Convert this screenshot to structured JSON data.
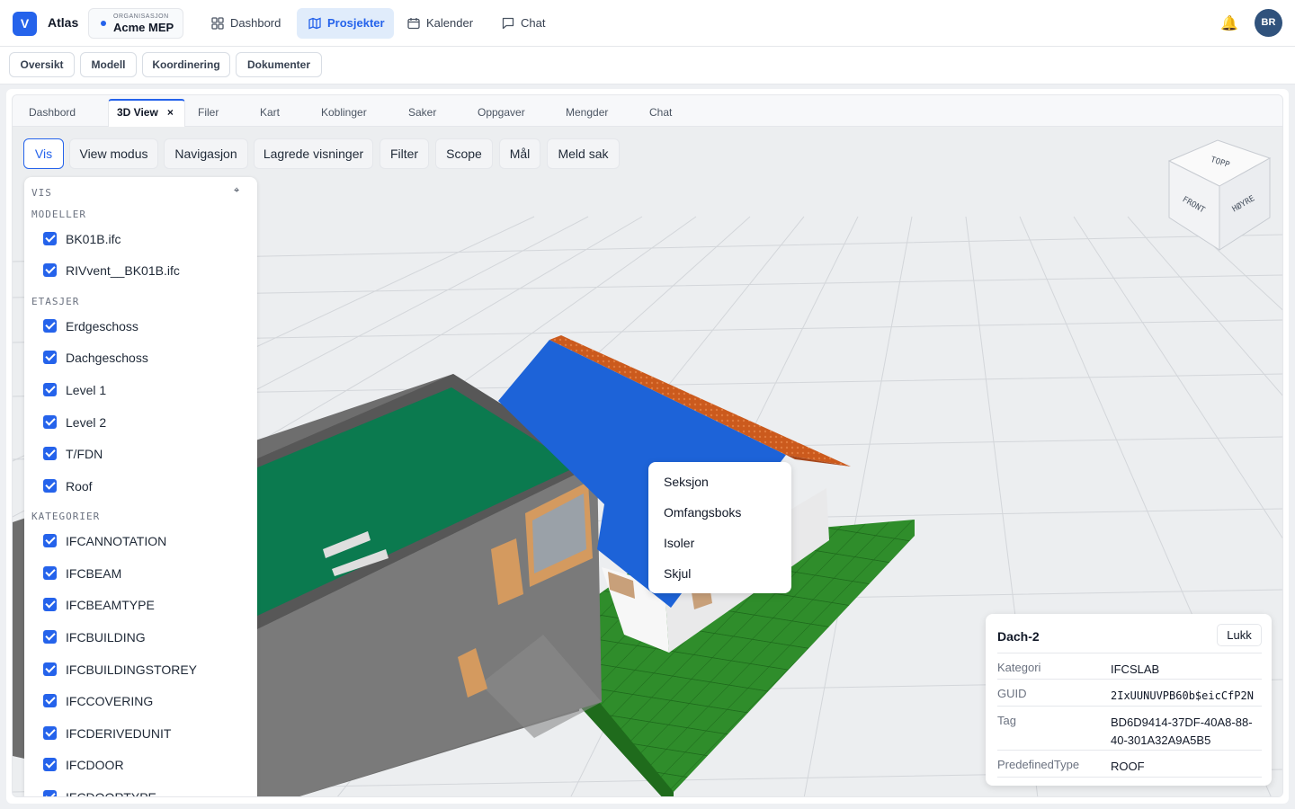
{
  "app": {
    "logo_letter": "V",
    "name": "Atlas"
  },
  "org": {
    "label": "ORGANISASJON",
    "name": "Acme MEP"
  },
  "nav": [
    {
      "label": "Dashbord",
      "icon": "grid-icon"
    },
    {
      "label": "Prosjekter",
      "icon": "map-icon",
      "active": true
    },
    {
      "label": "Kalender",
      "icon": "calendar-icon"
    },
    {
      "label": "Chat",
      "icon": "chat-icon"
    }
  ],
  "user": {
    "initials": "BR"
  },
  "subtabs": [
    "Oversikt",
    "Modell",
    "Koordinering",
    "Dokumenter"
  ],
  "viewer_tabs": [
    "Dashbord",
    "3D View",
    "Filer",
    "Kart",
    "Koblinger",
    "Saker",
    "Oppgaver",
    "Mengder",
    "Chat"
  ],
  "active_viewer_tab": "3D View",
  "close_glyph": "×",
  "toolbar": [
    "Vis",
    "View modus",
    "Navigasjon",
    "Lagrede visninger",
    "Filter",
    "Scope",
    "Mål",
    "Meld sak"
  ],
  "panel": {
    "title": "VIS",
    "models_heading": "MODELLER",
    "models": [
      "BK01B.ifc",
      "RIVvent__BK01B.ifc"
    ],
    "storeys_heading": "ETASJER",
    "storeys": [
      "Erdgeschoss",
      "Dachgeschoss",
      "Level 1",
      "Level 2",
      "T/FDN",
      "Roof"
    ],
    "categories_heading": "KATEGORIER",
    "categories": [
      "IFCANNOTATION",
      "IFCBEAM",
      "IFCBEAMTYPE",
      "IFCBUILDING",
      "IFCBUILDINGSTOREY",
      "IFCCOVERING",
      "IFCDERIVEDUNIT",
      "IFCDOOR",
      "IFCDOORTYPE"
    ]
  },
  "viewcube": {
    "top": "TOPP",
    "front": "FRONT",
    "right": "HØYRE"
  },
  "context_menu": [
    "Seksjon",
    "Omfangsboks",
    "Isoler",
    "Skjul"
  ],
  "properties": {
    "title": "Dach-2",
    "close_label": "Lukk",
    "rows": [
      {
        "key": "Kategori",
        "value": "IFCSLAB"
      },
      {
        "key": "GUID",
        "value": "2IxUUNUVPB60b$eicCfP2N"
      },
      {
        "key": "Tag",
        "value": "BD6D9414-37DF-40A8-88-40-301A32A9A5B5"
      },
      {
        "key": "PredefinedType",
        "value": "ROOF"
      }
    ]
  },
  "colors": {
    "accent": "#2563eb",
    "roof_blue": "#1d63d8",
    "roof_green": "#057a4e",
    "ground_green": "#2d8c2a",
    "wall_gray": "#707070",
    "tile_orange": "#c8581c"
  }
}
